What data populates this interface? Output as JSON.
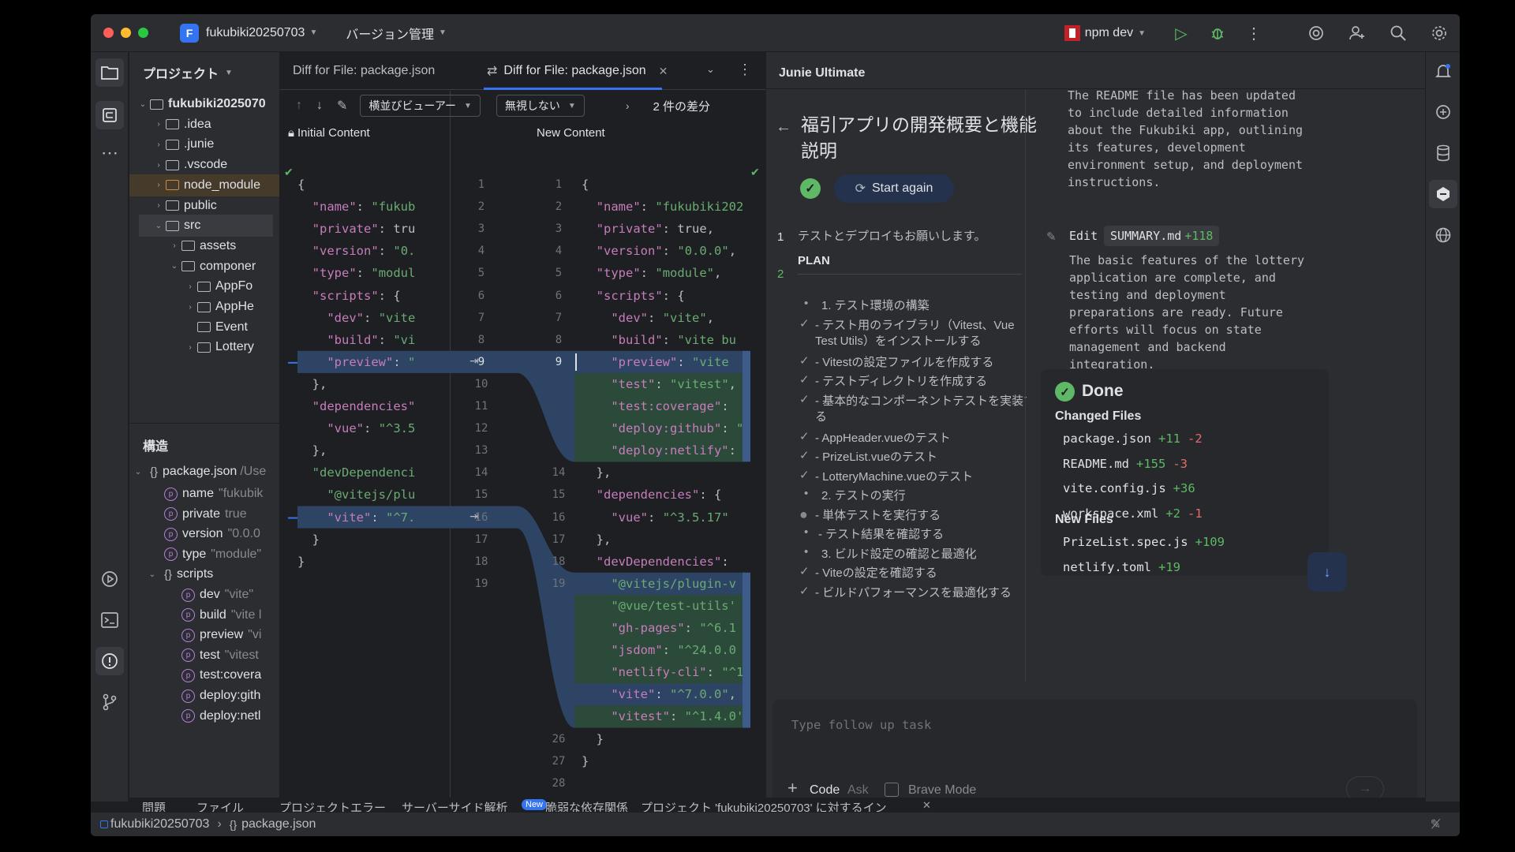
{
  "titlebar": {
    "project_badge": "F",
    "project_name": "fukubiki20250703",
    "vcs_menu": "バージョン管理",
    "run_config": "npm dev",
    "colors": {
      "traffic_red": "#ff5f57",
      "traffic_yellow": "#febc2e",
      "traffic_green": "#28c840",
      "run_green": "#5fb865"
    }
  },
  "project_panel": {
    "title": "プロジェクト",
    "tree": [
      {
        "label": "fukubiki2025070",
        "expanded": true
      },
      {
        "label": ".idea"
      },
      {
        "label": ".junie"
      },
      {
        "label": ".vscode"
      },
      {
        "label": "node_module"
      },
      {
        "label": "public"
      },
      {
        "label": "src",
        "expanded": true
      },
      {
        "label": "assets"
      },
      {
        "label": "componer",
        "expanded": true
      },
      {
        "label": "AppFo"
      },
      {
        "label": "AppHe"
      },
      {
        "label": "Event"
      },
      {
        "label": "Lottery"
      }
    ]
  },
  "structure_panel": {
    "title": "構造",
    "root_label": "package.json",
    "root_path": "/Use",
    "items": [
      {
        "name": "name",
        "value": "\"fukubik"
      },
      {
        "name": "private",
        "value": "true"
      },
      {
        "name": "version",
        "value": "\"0.0.0"
      },
      {
        "name": "type",
        "value": "\"module\""
      }
    ],
    "scripts_label": "scripts",
    "scripts": [
      {
        "name": "dev",
        "value": "\"vite\""
      },
      {
        "name": "build",
        "value": "\"vite l"
      },
      {
        "name": "preview",
        "value": "\"vi"
      },
      {
        "name": "test",
        "value": "\"vitest"
      },
      {
        "name": "test:covera",
        "value": ""
      },
      {
        "name": "deploy:gith",
        "value": ""
      },
      {
        "name": "deploy:netl",
        "value": ""
      }
    ]
  },
  "editor": {
    "tab_inactive": "Diff for File: package.json",
    "tab_active": "Diff for File: package.json",
    "viewer_mode": "横並びビューアー",
    "ignore_mode": "無視しない",
    "diff_count": "2 件の差分",
    "left_header": "Initial Content",
    "right_header": "New Content",
    "left_lines": [
      "{",
      "  \"name\": \"fukubik",
      "  \"private\": true,",
      "  \"version\": \"0.0.",
      "  \"type\": \"module\"",
      "  \"scripts\": {",
      "    \"dev\": \"vite\",",
      "    \"build\": \"vite",
      "    \"preview\": \"vi",
      "  },",
      "  \"dependencies\":",
      "    \"vue\": \"^3.5.1",
      "  },",
      "  \"devDependencies",
      "    \"@vitejs/plugi",
      "    \"vite\": \"^7.0.",
      "  }",
      "}"
    ],
    "left_numbers": [
      "1",
      "2",
      "3",
      "4",
      "5",
      "6",
      "7",
      "8",
      "9",
      "10",
      "11",
      "12",
      "13",
      "14",
      "15",
      "16",
      "17",
      "18",
      "19"
    ],
    "right_numbers": [
      "1",
      "2",
      "3",
      "4",
      "5",
      "6",
      "7",
      "8",
      "9",
      "14",
      "15",
      "16",
      "17",
      "18",
      "19",
      "26",
      "27",
      "28"
    ],
    "right_lines": [
      "{",
      "  \"name\": \"fukubiki2025",
      "  \"private\": true,",
      "  \"version\": \"0.0.0\",",
      "  \"type\": \"module\",",
      "  \"scripts\": {",
      "    \"dev\": \"vite\",",
      "    \"build\": \"vite bu",
      "    \"preview\": \"vite",
      "    \"test\": \"vitest\",",
      "    \"test:coverage\":",
      "    \"deploy:github\": \"r",
      "    \"deploy:netlify\": '",
      "  },",
      "  \"dependencies\": {",
      "    \"vue\": \"^3.5.17\"",
      "  },",
      "  \"devDependencies\":",
      "    \"@vitejs/plugin-v",
      "    \"@vue/test-utils'",
      "    \"gh-pages\": \"^6.1",
      "    \"jsdom\": \"^24.0.0",
      "    \"netlify-cli\": \"^1",
      "    \"vite\": \"^7.0.0\",",
      "    \"vitest\": \"^1.4.0'",
      "  }",
      "}"
    ]
  },
  "junie": {
    "title": "Junie Ultimate",
    "task_title_line1": "福引アプリの開発概要と機能",
    "task_title_line2": "説明",
    "start_again": "Start again",
    "step1_num": "1",
    "step1_text": "テストとデプロイもお願いします。",
    "step2_num": "2",
    "plan_label": "PLAN",
    "plan": [
      {
        "mark": "•",
        "text": "1. テスト環境の構築"
      },
      {
        "mark": "✓",
        "text": "- テスト用のライブラリ（Vitest、Vue",
        "cont": "Test Utils）をインストールする"
      },
      {
        "mark": "✓",
        "text": "- Vitestの設定ファイルを作成する"
      },
      {
        "mark": "✓",
        "text": "- テストディレクトリを作成する"
      },
      {
        "mark": "✓",
        "text": "- 基本的なコンポーネントテストを実装す",
        "cont": "る"
      },
      {
        "mark": "✓",
        "text": "- AppHeader.vueのテスト"
      },
      {
        "mark": "✓",
        "text": "- PrizeList.vueのテスト"
      },
      {
        "mark": "✓",
        "text": "- LotteryMachine.vueのテスト"
      },
      {
        "mark": "•",
        "text": "2. テストの実行"
      },
      {
        "mark": "◐",
        "text": "- 単体テストを実行する"
      },
      {
        "mark": "•",
        "text": "- テスト結果を確認する"
      },
      {
        "mark": "•",
        "text": "3. ビルド設定の確認と最適化"
      },
      {
        "mark": "✓",
        "text": "- Viteの設定を確認する"
      },
      {
        "mark": "✓",
        "text": "- ビルドパフォーマンスを最適化する"
      }
    ],
    "readme_lines": [
      "The README file has been updated",
      "to include detailed information",
      "about the Fukubiki app, outlining",
      "its features, development",
      "environment setup, and deployment",
      "instructions."
    ],
    "edit_label": "Edit",
    "edit_file": "SUMMARY.md",
    "edit_added": "+118",
    "summary_lines": [
      "The basic features of the lottery",
      "application are complete, and",
      "testing and deployment",
      "preparations are ready. Future",
      "efforts will focus on state",
      "management and backend",
      "integration."
    ],
    "done_label": "Done",
    "changed_files_label": "Changed Files",
    "changed_files": [
      {
        "file": "package.json",
        "added": "+11",
        "removed": "-2"
      },
      {
        "file": "README.md",
        "added": "+155",
        "removed": "-3"
      },
      {
        "file": "vite.config.js",
        "added": "+36",
        "removed": ""
      },
      {
        "file": "workspace.xml",
        "added": "+2",
        "removed": "-1"
      }
    ],
    "new_files_label": "New Files",
    "new_files": [
      {
        "file": "PrizeList.spec.js",
        "added": "+109"
      },
      {
        "file": "netlify.toml",
        "added": "+19"
      }
    ],
    "input_placeholder": "Type follow up task",
    "mode_code": "Code",
    "mode_ask": "Ask",
    "brave_mode": "Brave Mode"
  },
  "bottom_tabs": [
    "問題",
    "ファイル",
    "プロジェクトエラー",
    "サーバーサイド解析",
    "脆弱な依存関係",
    "プロジェクト 'fukubiki20250703' に対するイン"
  ],
  "bottom_new_badge": "New",
  "status": {
    "crumb_project": "fukubiki20250703",
    "crumb_file": "package.json"
  }
}
